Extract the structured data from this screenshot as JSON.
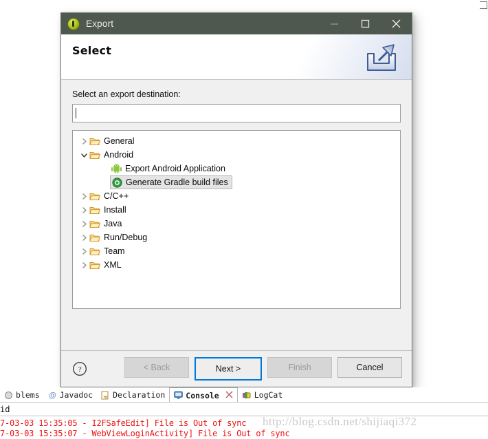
{
  "dialog": {
    "title": "Export",
    "title_icon": "eclipse-export-icon",
    "window_controls": {
      "minimize": "minimize-icon",
      "maximize": "maximize-icon",
      "close": "close-icon"
    },
    "header": {
      "title": "Select",
      "banner_icon": "export-tray-arrow-icon"
    },
    "destination": {
      "label": "Select an export destination:",
      "value": "",
      "placeholder": ""
    },
    "tree": {
      "items": [
        {
          "label": "General",
          "level": 1,
          "twisty": "collapsed",
          "icon": "folder-icon",
          "selected": false
        },
        {
          "label": "Android",
          "level": 1,
          "twisty": "expanded",
          "icon": "folder-icon",
          "selected": false
        },
        {
          "label": "Export Android Application",
          "level": 2,
          "twisty": "none",
          "icon": "android-icon",
          "selected": false
        },
        {
          "label": "Generate Gradle build files",
          "level": 2,
          "twisty": "none",
          "icon": "gradle-icon",
          "selected": true
        },
        {
          "label": "C/C++",
          "level": 1,
          "twisty": "collapsed",
          "icon": "folder-icon",
          "selected": false
        },
        {
          "label": "Install",
          "level": 1,
          "twisty": "collapsed",
          "icon": "folder-icon",
          "selected": false
        },
        {
          "label": "Java",
          "level": 1,
          "twisty": "collapsed",
          "icon": "folder-icon",
          "selected": false
        },
        {
          "label": "Run/Debug",
          "level": 1,
          "twisty": "collapsed",
          "icon": "folder-icon",
          "selected": false
        },
        {
          "label": "Team",
          "level": 1,
          "twisty": "collapsed",
          "icon": "folder-icon",
          "selected": false
        },
        {
          "label": "XML",
          "level": 1,
          "twisty": "collapsed",
          "icon": "folder-icon",
          "selected": false
        }
      ]
    },
    "buttons": {
      "help": "help-icon",
      "back": "< Back",
      "next": "Next >",
      "finish": "Finish",
      "cancel": "Cancel"
    },
    "annotation": {
      "type": "red-arrow",
      "points_at": "Generate Gradle build files"
    }
  },
  "eclipse": {
    "tabs": [
      {
        "label": "blems",
        "icon": "problems-icon",
        "active": false
      },
      {
        "label": "Javadoc",
        "icon": "javadoc-at-icon",
        "active": false
      },
      {
        "label": "Declaration",
        "icon": "declaration-icon",
        "active": false
      },
      {
        "label": "Console",
        "icon": "console-icon",
        "active": true
      },
      {
        "label": "LogCat",
        "icon": "logcat-icon",
        "active": false
      }
    ],
    "console_name": "id",
    "console_lines": [
      "7-03-03 15:35:05 - I2FSafeEdit] File is Out of sync",
      "7-03-03 15:35:07 - WebViewLoginActivity] File is Out of sync"
    ]
  },
  "watermark": "http://blog.csdn.net/shijiaqi372",
  "colors": {
    "titlebar": "#4f584e",
    "dialog_bg": "#f0f0f0",
    "focus_blue": "#0078d7",
    "console_red": "#ee1111",
    "selection_gray": "#e4e4e4"
  }
}
